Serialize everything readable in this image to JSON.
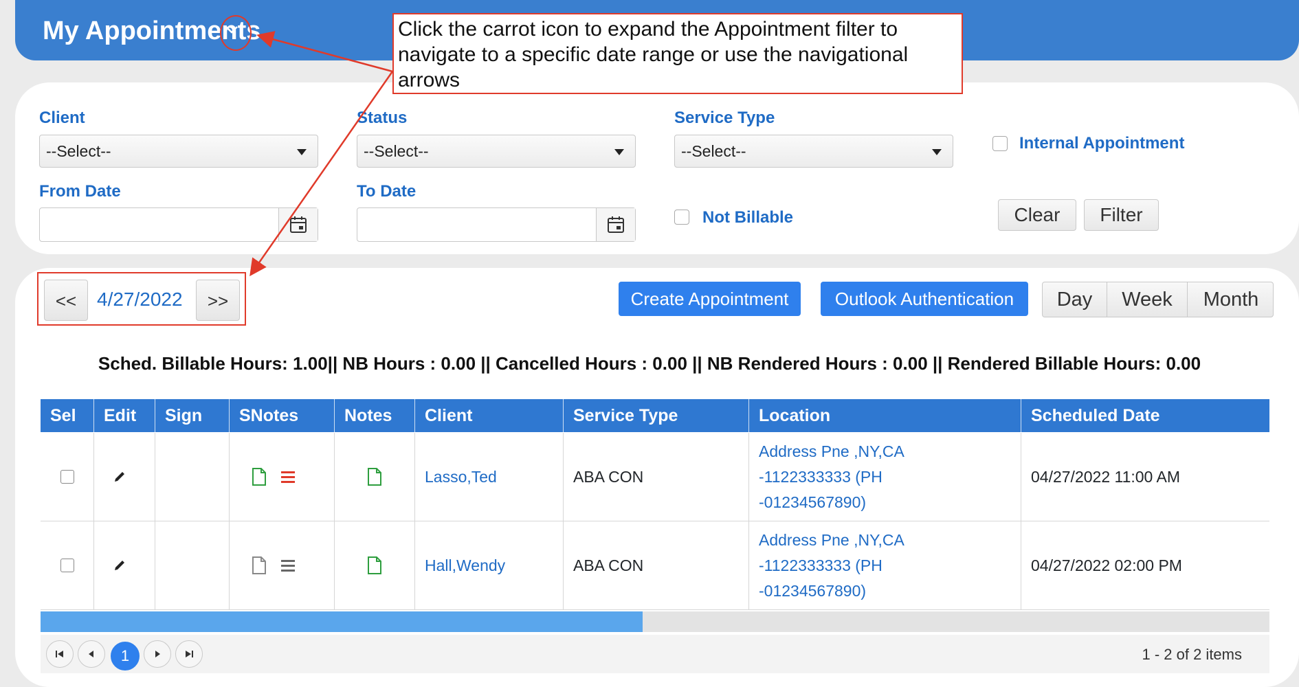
{
  "header": {
    "title": "My Appointments"
  },
  "annotation": {
    "text": "Click the carrot icon to expand the Appointment filter to navigate to a specific date range or use the navigational arrows"
  },
  "filters": {
    "client_label": "Client",
    "client_value": "--Select--",
    "status_label": "Status",
    "status_value": "--Select--",
    "service_type_label": "Service Type",
    "service_type_value": "--Select--",
    "internal_appointment_label": "Internal Appointment",
    "from_date_label": "From Date",
    "from_date_value": "",
    "to_date_label": "To Date",
    "to_date_value": "",
    "not_billable_label": "Not Billable",
    "clear_label": "Clear",
    "filter_label": "Filter"
  },
  "navigator": {
    "prev_label": "<<",
    "current_date": "4/27/2022",
    "next_label": ">>"
  },
  "toolbar": {
    "create_label": "Create Appointment",
    "outlook_label": "Outlook Authentication",
    "views": [
      "Day",
      "Week",
      "Month"
    ]
  },
  "summary": "Sched. Billable Hours: 1.00|| NB Hours : 0.00 || Cancelled Hours : 0.00 || NB Rendered Hours : 0.00 || Rendered Billable Hours: 0.00",
  "table": {
    "columns": [
      "Sel",
      "Edit",
      "Sign",
      "SNotes",
      "Notes",
      "Client",
      "Service Type",
      "Location",
      "Scheduled Date"
    ],
    "rows": [
      {
        "client": "Lasso,Ted",
        "service_type": "ABA CON",
        "location_lines": [
          "Address Pne ,NY,CA",
          "-1122333333 (PH",
          "-01234567890)"
        ],
        "scheduled_date": "04/27/2022 11:00 AM",
        "snotes_doc_color": "#2e9e3e",
        "snotes_list_color": "#e03a2a"
      },
      {
        "client": "Hall,Wendy",
        "service_type": "ABA CON",
        "location_lines": [
          "Address Pne ,NY,CA",
          "-1122333333 (PH",
          "-01234567890)"
        ],
        "scheduled_date": "04/27/2022 02:00 PM",
        "snotes_doc_color": "#888888",
        "snotes_list_color": "#666666"
      }
    ],
    "horizontal_scroll_fraction": 0.49
  },
  "pager": {
    "current_page": "1",
    "info": "1 - 2 of 2 items"
  },
  "colors": {
    "header_bg": "#3a7fcf",
    "accent": "#2f80ed",
    "label_blue": "#1f6bc5",
    "annotation_red": "#e03a2a"
  }
}
